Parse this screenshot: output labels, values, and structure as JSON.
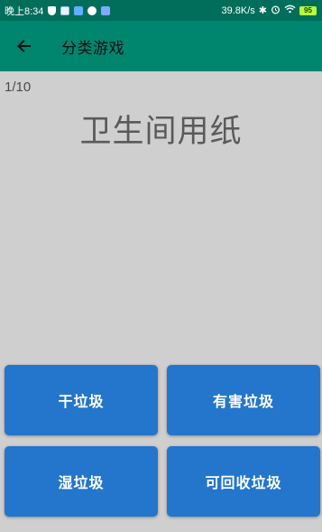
{
  "status_bar": {
    "time": "晚上8:34",
    "network_speed": "39.8K/s",
    "battery": "95"
  },
  "app_bar": {
    "title": "分类游戏",
    "back_icon": "arrow-left-icon"
  },
  "game": {
    "progress": "1/10",
    "item": "卫生间用纸"
  },
  "answers": {
    "dry": "干垃圾",
    "hazardous": "有害垃圾",
    "wet": "湿垃圾",
    "recyclable": "可回收垃圾"
  },
  "colors": {
    "status_bar": "#006e5a",
    "app_bar": "#00856f",
    "background": "#cfcfcf",
    "button": "#2376cc"
  }
}
